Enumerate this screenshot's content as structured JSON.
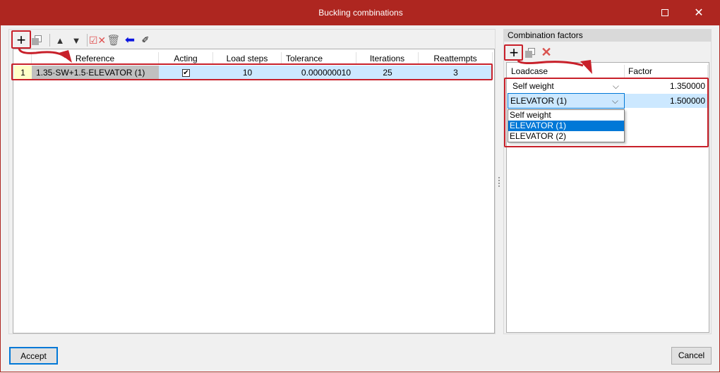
{
  "window": {
    "title": "Buckling combinations"
  },
  "left": {
    "columns": [
      "",
      "Reference",
      "Acting",
      "Load steps",
      "Tolerance",
      "Iterations",
      "Reattempts"
    ],
    "rows": [
      {
        "index": "1",
        "reference": "1.35·SW+1.5·ELEVATOR (1)",
        "acting": true,
        "load_steps": "10",
        "tolerance": "0.000000010",
        "iterations": "25",
        "reattempts": "3"
      }
    ]
  },
  "right": {
    "title": "Combination factors",
    "columns": [
      "Loadcase",
      "Factor"
    ],
    "rows": [
      {
        "loadcase": "Self weight",
        "factor": "1.350000"
      },
      {
        "loadcase": "ELEVATOR (1)",
        "factor": "1.500000"
      }
    ],
    "dropdown_options": [
      "Self weight",
      "ELEVATOR (1)",
      "ELEVATOR (2)"
    ],
    "selected_option": "ELEVATOR (1)"
  },
  "footer": {
    "accept": "Accept",
    "cancel": "Cancel"
  },
  "colors": {
    "accent": "#ae2620",
    "annotation": "#c8202a",
    "selection": "#cce8ff",
    "highlight": "#0078d7"
  }
}
